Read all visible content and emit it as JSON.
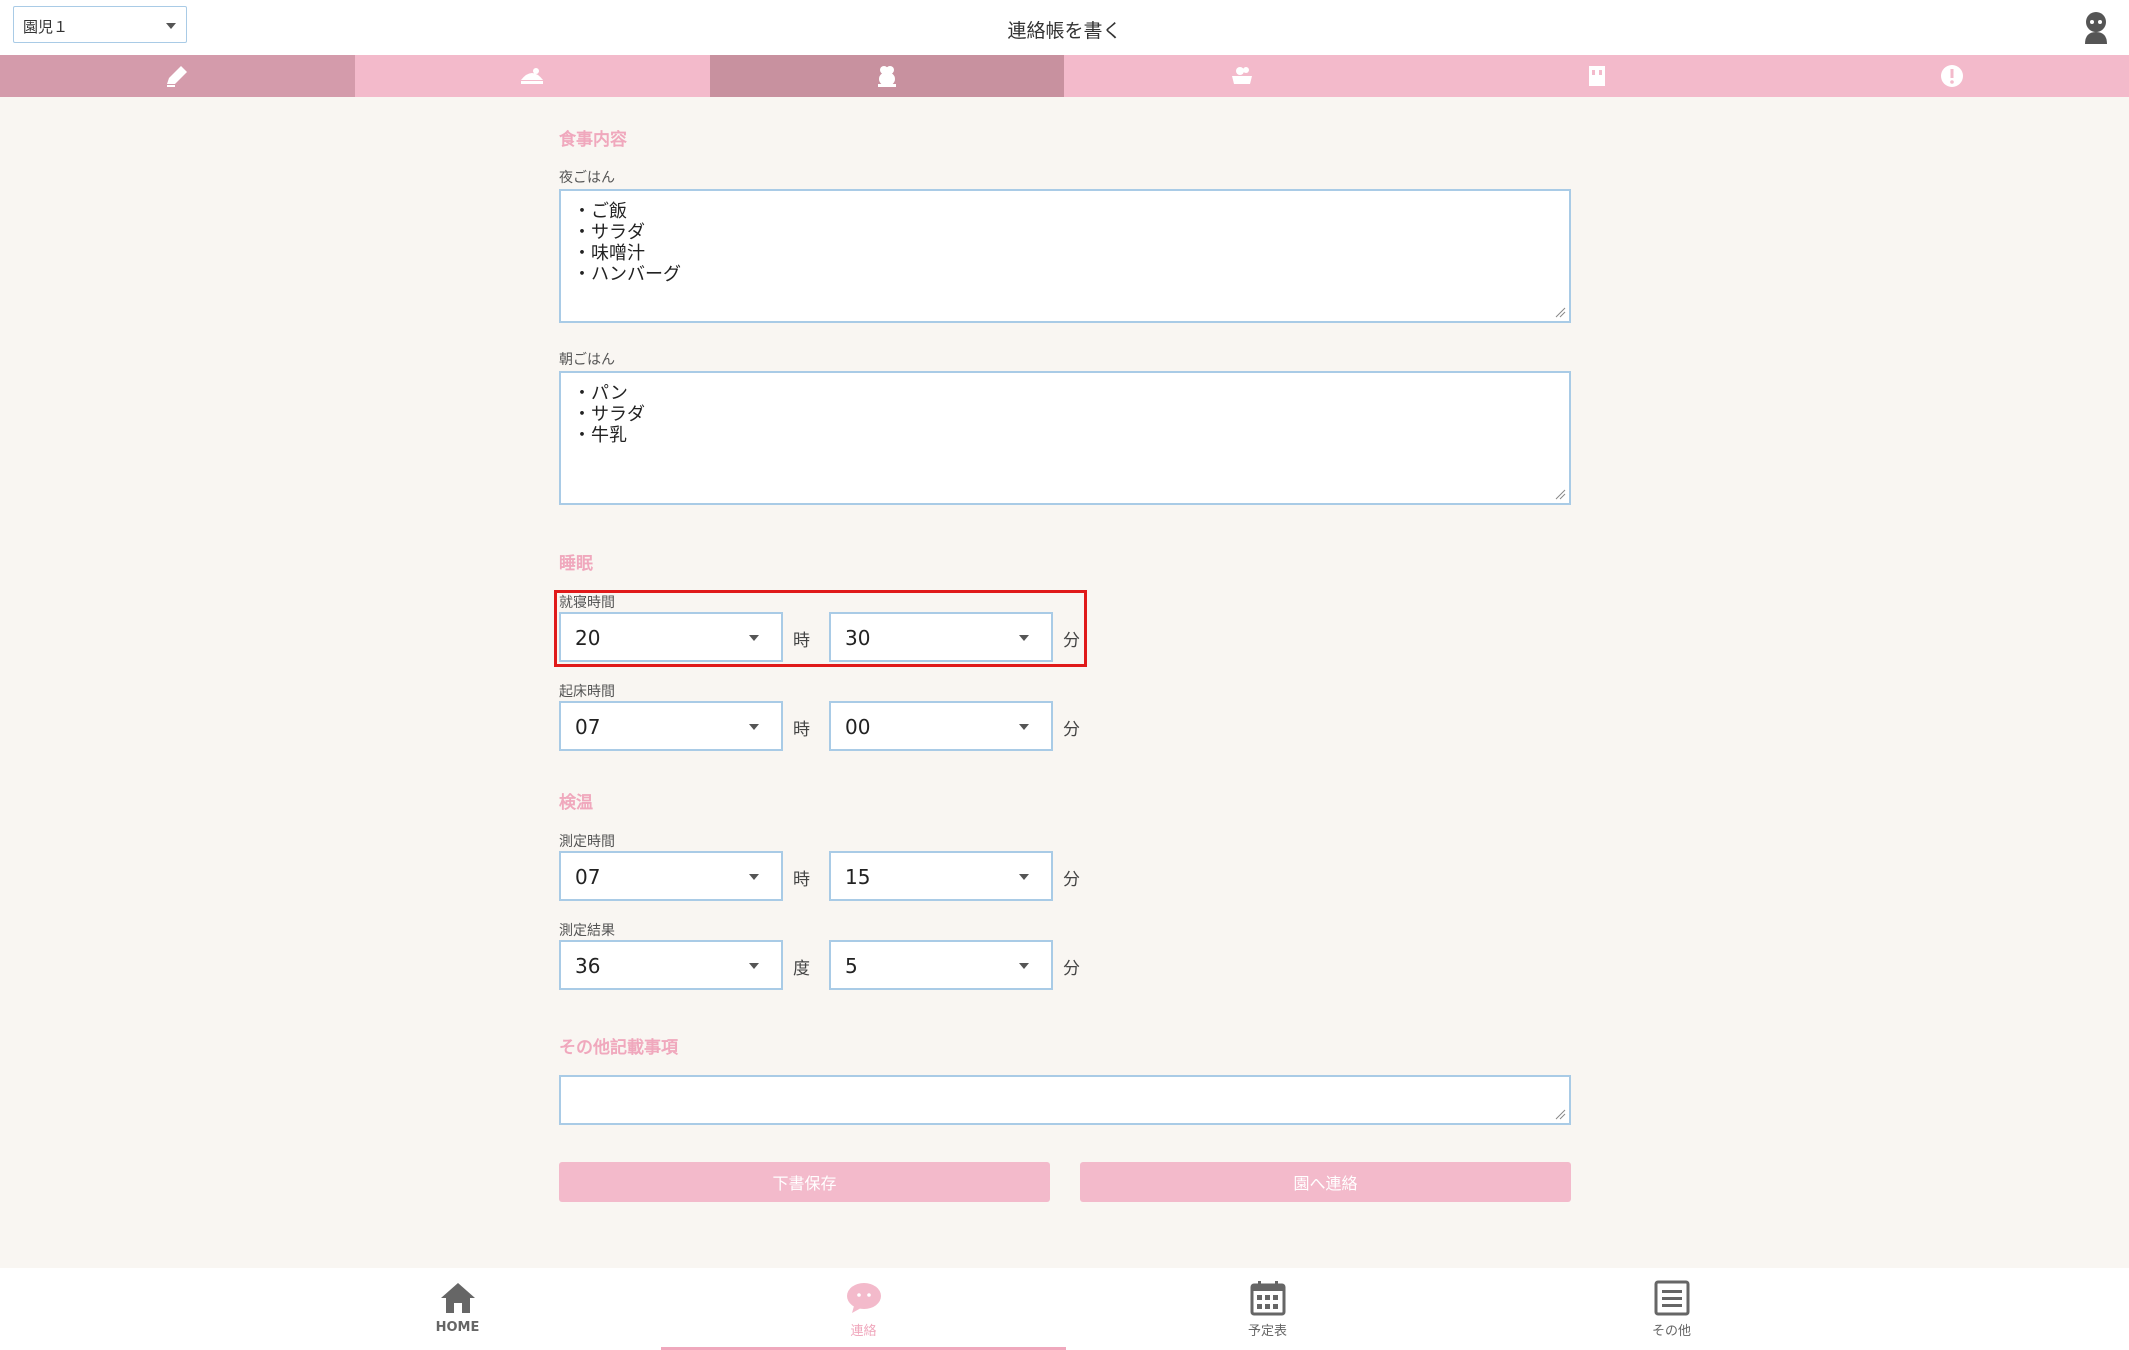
{
  "header": {
    "child_select_value": "園児１",
    "title": "連絡帳を書く"
  },
  "tabs": [
    {
      "icon": "pencil-icon"
    },
    {
      "icon": "food-icon"
    },
    {
      "icon": "sleep-icon"
    },
    {
      "icon": "bath-icon"
    },
    {
      "icon": "toilet-icon"
    },
    {
      "icon": "alert-icon"
    }
  ],
  "meal": {
    "section_title": "食事内容",
    "dinner_label": "夜ごはん",
    "dinner_text": "・ご飯\n・サラダ\n・味噌汁\n・ハンバーグ",
    "breakfast_label": "朝ごはん",
    "breakfast_text": "・パン\n・サラダ\n・牛乳"
  },
  "sleep": {
    "section_title": "睡眠",
    "bedtime_label": "就寝時間",
    "bedtime_hour": "20",
    "bedtime_minute": "30",
    "wake_label": "起床時間",
    "wake_hour": "07",
    "wake_minute": "00",
    "hour_unit": "時",
    "minute_unit": "分"
  },
  "temperature": {
    "section_title": "検温",
    "time_label": "測定時間",
    "time_hour": "07",
    "time_minute": "15",
    "result_label": "測定結果",
    "result_degree": "36",
    "result_decimal": "5",
    "degree_unit": "度",
    "decimal_unit": "分",
    "hour_unit": "時",
    "minute_unit": "分"
  },
  "other": {
    "section_title": "その他記載事項",
    "text": ""
  },
  "buttons": {
    "save_draft": "下書保存",
    "send": "園へ連絡"
  },
  "bottom_nav": {
    "home": "HOME",
    "contact": "連絡",
    "schedule": "予定表",
    "other": "その他"
  },
  "colors": {
    "accent_pink": "#f3bacb",
    "section_pink": "#f0a8bd",
    "field_border": "#a9cbe6",
    "highlight_red": "#e01a1a",
    "background": "#f9f6f2"
  }
}
